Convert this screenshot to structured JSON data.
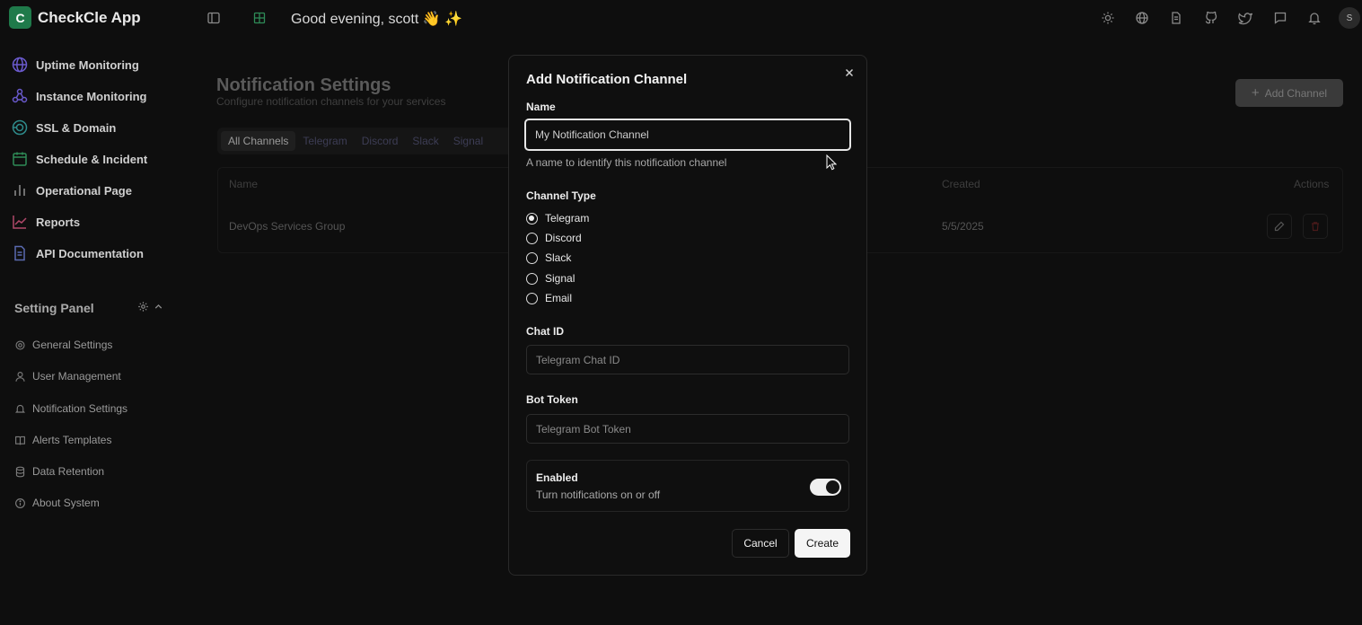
{
  "app": {
    "logo_letter": "C",
    "title": "CheckCle App"
  },
  "header": {
    "greeting": "Good evening, scott 👋 ✨",
    "avatar_initial": "S"
  },
  "sidebar": {
    "items": [
      {
        "label": "Uptime Monitoring",
        "icon": "globe-icon"
      },
      {
        "label": "Instance Monitoring",
        "icon": "network-icon"
      },
      {
        "label": "SSL & Domain",
        "icon": "shield-globe-icon"
      },
      {
        "label": "Schedule & Incident",
        "icon": "calendar-icon"
      },
      {
        "label": "Operational Page",
        "icon": "bar-chart-icon"
      },
      {
        "label": "Reports",
        "icon": "line-chart-icon"
      },
      {
        "label": "API Documentation",
        "icon": "document-icon"
      }
    ],
    "setting_panel": {
      "title": "Setting Panel",
      "items": [
        {
          "label": "General Settings",
          "icon": "gear-icon"
        },
        {
          "label": "User Management",
          "icon": "user-icon"
        },
        {
          "label": "Notification Settings",
          "icon": "bell-icon"
        },
        {
          "label": "Alerts Templates",
          "icon": "book-icon"
        },
        {
          "label": "Data Retention",
          "icon": "database-icon"
        },
        {
          "label": "About System",
          "icon": "info-icon"
        }
      ]
    }
  },
  "main": {
    "title": "Notification Settings",
    "subtitle": "Configure notification channels for your services",
    "add_button": "Add Channel",
    "tabs": [
      "All Channels",
      "Telegram",
      "Discord",
      "Slack",
      "Signal"
    ],
    "table": {
      "headers": {
        "name": "Name",
        "created": "Created",
        "actions": "Actions"
      },
      "rows": [
        {
          "name": "DevOps Services Group",
          "created": "5/5/2025"
        }
      ]
    }
  },
  "modal": {
    "title": "Add Notification Channel",
    "name_label": "Name",
    "name_value": "My Notification Channel",
    "name_help": "A name to identify this notification channel",
    "channel_type_label": "Channel Type",
    "channel_types": [
      "Telegram",
      "Discord",
      "Slack",
      "Signal",
      "Email"
    ],
    "selected_channel": "Telegram",
    "chat_id_label": "Chat ID",
    "chat_id_placeholder": "Telegram Chat ID",
    "bot_token_label": "Bot Token",
    "bot_token_placeholder": "Telegram Bot Token",
    "enabled_title": "Enabled",
    "enabled_sub": "Turn notifications on or off",
    "enabled": true,
    "cancel_label": "Cancel",
    "create_label": "Create"
  }
}
